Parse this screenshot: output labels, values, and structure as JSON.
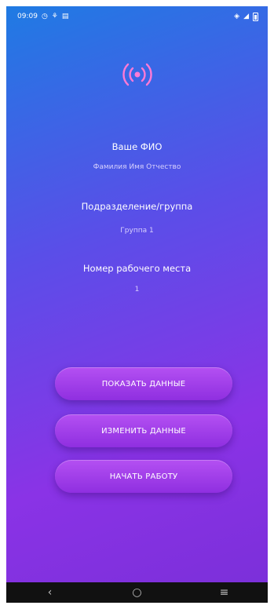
{
  "status_bar": {
    "time": "09:09",
    "left_icons": [
      "alarm-icon",
      "notification-icon",
      "message-icon"
    ],
    "right_icons": [
      "wifi-icon",
      "signal-icon",
      "battery-icon"
    ]
  },
  "profile": {
    "fio_label": "Ваше ФИО",
    "fio_value": "Фамилия Имя Отчество",
    "group_label": "Подразделение/группа",
    "group_value": "Группа 1",
    "workplace_label": "Номер рабочего места",
    "workplace_value": "1"
  },
  "buttons": {
    "show": "ПОКАЗАТЬ ДАННЫЕ",
    "edit": "ИЗМЕНИТЬ ДАННЫЕ",
    "start": "НАЧАТЬ РАБОТУ"
  },
  "nav": {
    "back": "‹",
    "home": "○",
    "recents": "≡"
  },
  "colors": {
    "gradient_start": "#1f7be3",
    "gradient_end": "#8a33e6",
    "button": "#a442ee"
  }
}
